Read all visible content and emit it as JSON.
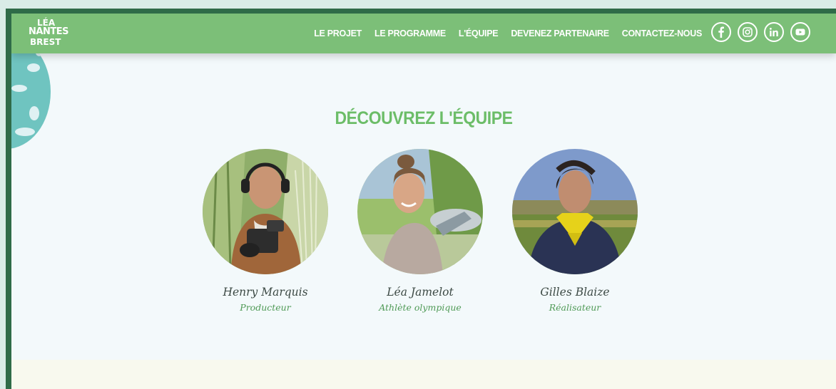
{
  "nav": {
    "logo": {
      "line1": "LÉA",
      "line2": "NANTES",
      "line3": "BREST"
    },
    "links": [
      {
        "label": "LE PROJET"
      },
      {
        "label": "LE PROGRAMME"
      },
      {
        "label": "L'ÉQUIPE"
      },
      {
        "label": "DEVENEZ PARTENAIRE"
      },
      {
        "label": "CONTACTEZ-NOUS"
      }
    ],
    "socials": [
      {
        "icon": "facebook-icon"
      },
      {
        "icon": "instagram-icon"
      },
      {
        "icon": "linkedin-icon"
      },
      {
        "icon": "youtube-icon"
      }
    ]
  },
  "section": {
    "title": "DÉCOUVREZ L'ÉQUIPE"
  },
  "team": [
    {
      "name": "Henry Marquis",
      "role": "Producteur"
    },
    {
      "name": "Léa Jamelot",
      "role": "Athlète olympique"
    },
    {
      "name": "Gilles Blaize",
      "role": "Réalisateur"
    }
  ],
  "colors": {
    "nav_bg": "#7cbf78",
    "title": "#6cbd68",
    "role": "#4f9a56",
    "frame": "#2f6b48"
  }
}
